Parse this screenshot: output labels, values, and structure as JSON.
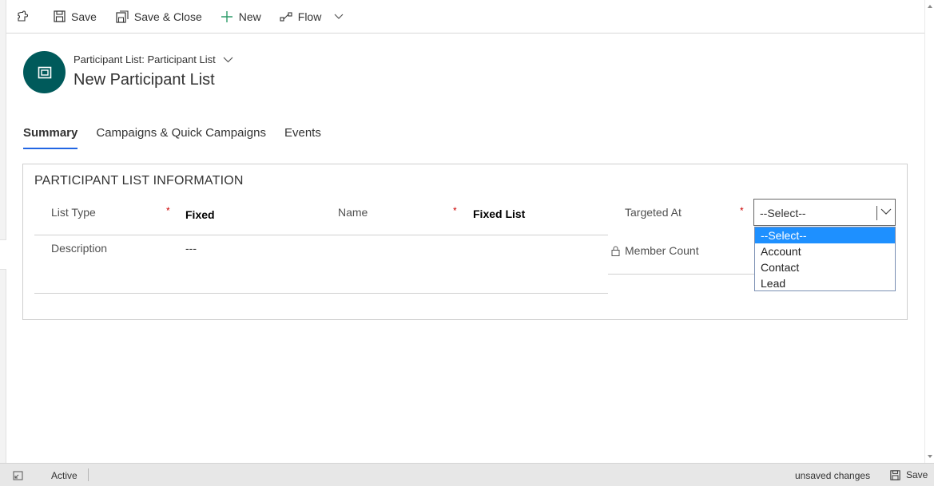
{
  "commandbar": {
    "items": [
      {
        "label": "Save",
        "icon": "save-icon"
      },
      {
        "label": "Save & Close",
        "icon": "save-close-icon"
      },
      {
        "label": "New",
        "icon": "plus-icon"
      },
      {
        "label": "Flow",
        "icon": "flow-icon"
      }
    ]
  },
  "header": {
    "entity_crumb": "Participant List: Participant List",
    "title": "New Participant List"
  },
  "tabs": [
    {
      "label": "Summary",
      "active": true
    },
    {
      "label": "Campaigns & Quick Campaigns"
    },
    {
      "label": "Events"
    }
  ],
  "section": {
    "title": "PARTICIPANT LIST INFORMATION",
    "required_marker": "*",
    "fields": {
      "list_type": {
        "label": "List Type",
        "value": "Fixed"
      },
      "name": {
        "label": "Name",
        "value": "Fixed List"
      },
      "targeted_at": {
        "label": "Targeted At",
        "value": "--Select--"
      },
      "description": {
        "label": "Description",
        "value": "---"
      },
      "member_count": {
        "label": "Member Count",
        "value": ""
      }
    }
  },
  "dropdown": {
    "options": [
      "--Select--",
      "Account",
      "Contact",
      "Lead"
    ],
    "selected": "--Select--"
  },
  "statusbar": {
    "status": "Active",
    "unsaved": "unsaved changes",
    "save_label": "Save"
  },
  "colors": {
    "accent": "#2266e3",
    "avatar_bg": "#005a5b",
    "required": "#c00000",
    "dropdown_highlight": "#1e90ff"
  }
}
